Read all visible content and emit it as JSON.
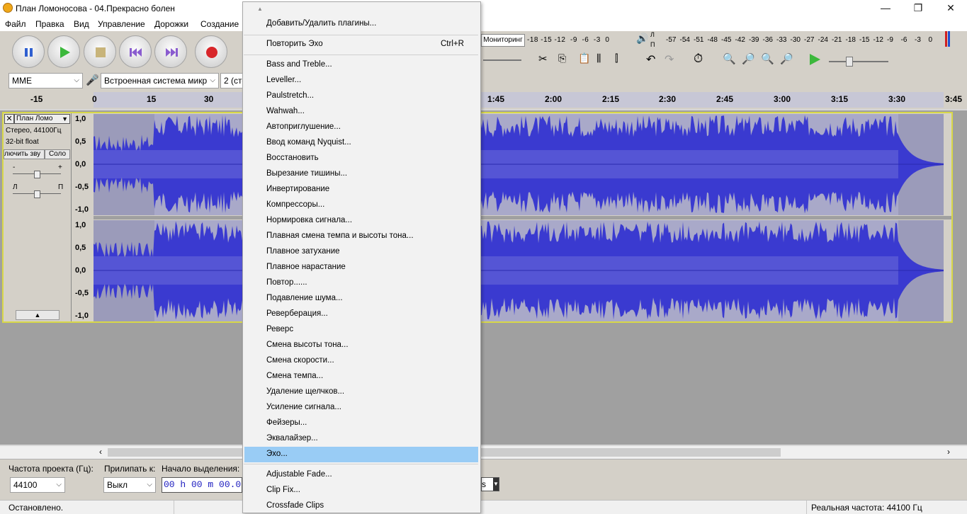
{
  "window": {
    "title": "План Ломоносова - 04.Прекрасно болен",
    "minimize": "—",
    "maximize": "❐",
    "close": "✕"
  },
  "menubar": [
    "Файл",
    "Правка",
    "Вид",
    "Управление",
    "Дорожки",
    "Создание"
  ],
  "meters": {
    "monitor_label": "Мониторинг",
    "rec_ticks": [
      "-18",
      "-15",
      "-12",
      "-9",
      "-6",
      "-3",
      "0"
    ],
    "play_ticks": [
      "-57",
      "-54",
      "-51",
      "-48",
      "-45",
      "-42",
      "-39",
      "-36",
      "-33",
      "-30",
      "-27",
      "-24",
      "-21",
      "-18",
      "-15",
      "-12",
      "-9",
      "-6",
      "-3",
      "0"
    ],
    "left_channel": "Л",
    "right_channel": "П"
  },
  "devices": {
    "host": "MME",
    "input_device": "Встроенная система микр",
    "channels": "2 (сте"
  },
  "ruler": {
    "ticks_left": [
      "-15",
      "0",
      "15",
      "30"
    ],
    "ticks_right": [
      "1:45",
      "2:00",
      "2:15",
      "2:30",
      "2:45",
      "3:00",
      "3:15",
      "3:30",
      "3:45"
    ]
  },
  "track": {
    "name": "План Ломо",
    "info1": "Стерео, 44100Гц",
    "info2": "32-bit float",
    "mute": "лючить зву",
    "solo": "Соло",
    "gain_minus": "-",
    "gain_plus": "+",
    "pan_left": "Л",
    "pan_right": "П",
    "yaxis_top": [
      "1,0",
      "0,5",
      "0,0",
      "-0,5",
      "-1,0"
    ],
    "yaxis_bottom": [
      "1,0",
      "0,5",
      "0,0",
      "-0,5",
      "-1,0"
    ]
  },
  "bottom": {
    "rate_label": "Частота проекта (Гц):",
    "rate_value": "44100",
    "snap_label": "Прилипать к:",
    "snap_value": "Выкл",
    "sel_start_label": "Начало выделения:",
    "sel_start_value": "00 h 00 m 00.0",
    "end_unit": "s"
  },
  "status": {
    "left": "Остановлено.",
    "right": "Реальная частота: 44100 Гц"
  },
  "context_menu": {
    "scroll_up": "▲",
    "items_top": [
      {
        "label": "Добавить/Удалить плагины...",
        "shortcut": ""
      },
      {
        "label": "Повторить Эхо",
        "shortcut": "Ctrl+R"
      }
    ],
    "effects": [
      "Bass and Treble...",
      "Leveller...",
      "Paulstretch...",
      "Wahwah...",
      "Автоприглушение...",
      "Ввод команд Nyquist...",
      "Восстановить",
      "Вырезание тишины...",
      "Инвертирование",
      "Компрессоры...",
      "Нормировка сигнала...",
      "Плавная смена темпа и высоты тона...",
      "Плавное затухание",
      "Плавное нарастание",
      "Повтор......",
      "Подавление шума...",
      "Реверберация...",
      "Реверс",
      "Смена высоты тона...",
      "Смена скорости...",
      "Смена темпа...",
      "Удаление щелчков...",
      "Усиление сигнала...",
      "Фейзеры...",
      "Эквалайзер...",
      "Эхо..."
    ],
    "plugins": [
      "Adjustable Fade...",
      "Clip Fix...",
      "Crossfade Clips"
    ],
    "highlighted": "Эхо...",
    "highlight_color": "#99ccf5"
  },
  "colors": {
    "waveform": "#3a3ad0",
    "waveform_selected": "#6b6bd9",
    "track_border": "#d8d848",
    "selection_bg": "#9b9bba"
  }
}
